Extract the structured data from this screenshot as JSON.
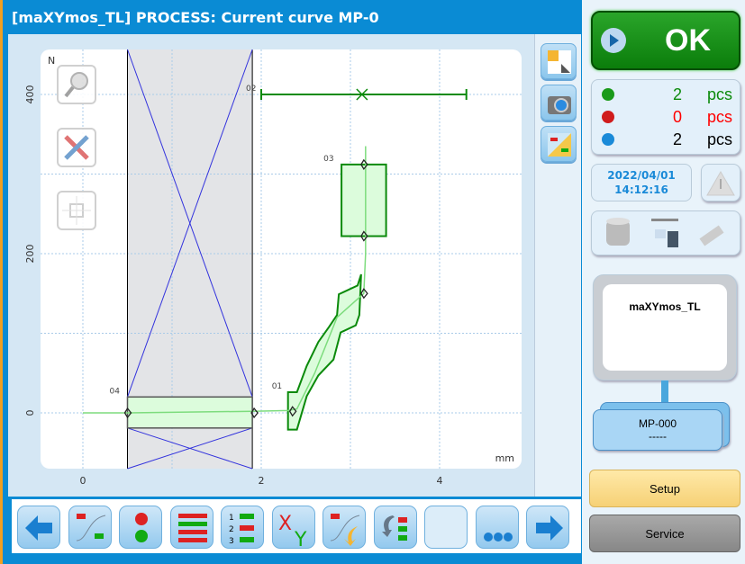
{
  "window": {
    "title": "[maXYmos_TL] PROCESS: Current curve MP-0"
  },
  "status": {
    "result": "OK",
    "ok_count": "2",
    "nok_count": "0",
    "total_count": "2",
    "unit": "pcs",
    "date": "2022/04/01",
    "time": "14:12:16",
    "device_name": "maXYmos_TL",
    "mp_name": "MP-000",
    "mp_sub": "-----"
  },
  "colors": {
    "ok": "#0b8a0b",
    "nok": "#ff0000",
    "accent": "#0a8bd4",
    "curve": "#7ddc7d",
    "window_line": "#0b8a0b",
    "envelope_fill": "#dcfcdc",
    "lines_blue": "#3333dd"
  },
  "buttons": {
    "setup": "Setup",
    "service": "Service"
  },
  "side_tools": [
    "fit-view-icon",
    "camera-icon",
    "curve-settings-icon"
  ],
  "overlay_tools": [
    "zoom-icon",
    "tools-icon",
    "crosshair-icon"
  ],
  "bottom_toolbar": [
    "back-arrow-icon",
    "curve-view-icon",
    "traffic-light-icon",
    "bar-list-icon",
    "numbered-list-icon",
    "xy-icon",
    "curve-import-icon",
    "sort-list-icon",
    "empty",
    "more-icon",
    "forward-arrow-icon"
  ],
  "chart_data": {
    "type": "line",
    "xlabel": "mm",
    "ylabel": "N",
    "xlim": [
      -0.5,
      4.9
    ],
    "ylim": [
      -70,
      460
    ],
    "xticks": [
      "0",
      "2",
      "4"
    ],
    "yticks": [
      "0",
      "200",
      "400"
    ],
    "grid": true,
    "curve": [
      [
        0,
        0
      ],
      [
        0.5,
        0
      ],
      [
        1.9,
        2
      ],
      [
        2.3,
        3
      ],
      [
        2.4,
        5
      ],
      [
        2.6,
        50
      ],
      [
        2.85,
        120
      ],
      [
        3.05,
        140
      ],
      [
        3.15,
        150
      ],
      [
        3.17,
        200
      ],
      [
        3.17,
        335
      ]
    ],
    "evaluation_elements": [
      {
        "label": "01",
        "type": "envelope",
        "points": [
          [
            2.3,
            26
          ],
          [
            2.4,
            26
          ],
          [
            2.51,
            59
          ],
          [
            2.64,
            89
          ],
          [
            2.76,
            108
          ],
          [
            2.85,
            123
          ],
          [
            2.87,
            149
          ],
          [
            3.08,
            160
          ],
          [
            3.12,
            174
          ],
          [
            3.1,
            123
          ],
          [
            3.06,
            110
          ],
          [
            2.89,
            101
          ],
          [
            2.81,
            67
          ],
          [
            2.64,
            47
          ],
          [
            2.51,
            21
          ],
          [
            2.4,
            -21
          ],
          [
            2.3,
            -21
          ]
        ]
      },
      {
        "label": "02",
        "type": "line-x",
        "y": 400,
        "xmin": 2.0,
        "xmax": 4.3,
        "marker_x": 3.13
      },
      {
        "label": "03",
        "type": "box",
        "xmin": 2.9,
        "xmax": 3.4,
        "ymin": 222,
        "ymax": 312
      },
      {
        "label": "04",
        "type": "box",
        "xmin": 0.5,
        "xmax": 1.9,
        "ymin": -19,
        "ymax": 20
      }
    ],
    "excluded_zone": {
      "xmin": 0.5,
      "xmax": 1.9
    },
    "markers": [
      [
        0.5,
        0
      ],
      [
        1.92,
        0
      ],
      [
        2.35,
        2
      ],
      [
        3.15,
        150
      ],
      [
        3.15,
        222
      ],
      [
        3.15,
        312
      ]
    ]
  }
}
